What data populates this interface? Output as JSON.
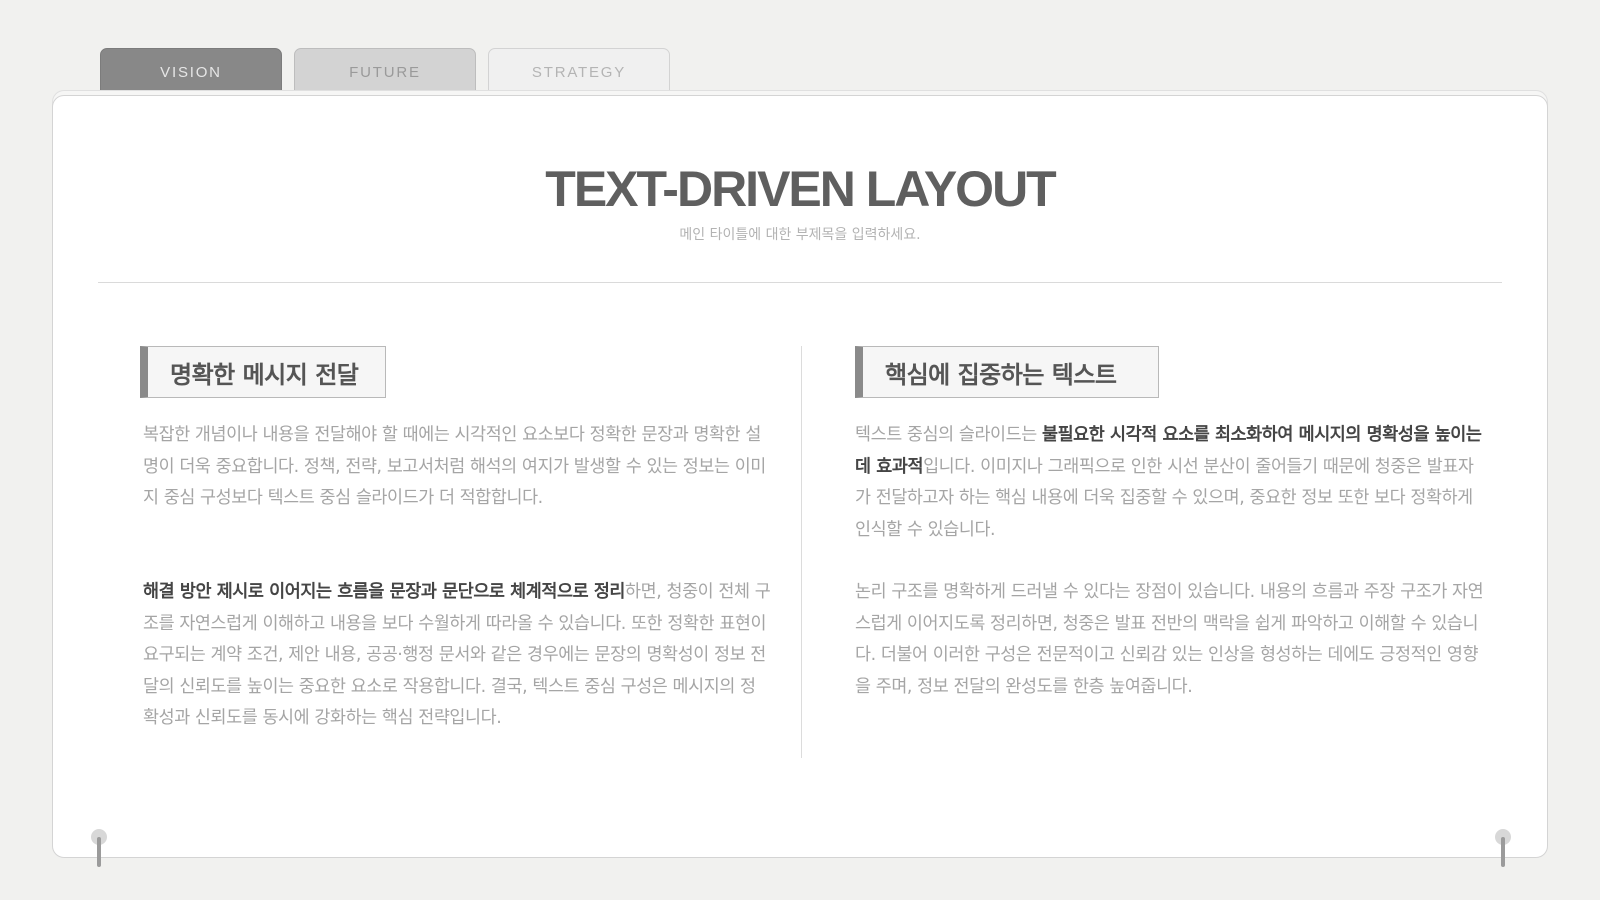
{
  "tabs": [
    {
      "label": "VISION",
      "active": true
    },
    {
      "label": "FUTURE",
      "active": false
    },
    {
      "label": "STRATEGY",
      "active": false
    }
  ],
  "title": "TEXT-DRIVEN LAYOUT",
  "subtitle": "메인 타이틀에 대한 부제목을 입력하세요.",
  "left": {
    "heading": "명확한 메시지 전달",
    "para1": "복잡한 개념이나 내용을 전달해야 할 때에는 시각적인 요소보다 정확한 문장과 명확한 설명이 더욱 중요합니다. 정책, 전략, 보고서처럼 해석의 여지가 발생할 수 있는 정보는 이미지 중심 구성보다 텍스트 중심 슬라이드가 더 적합합니다.",
    "para2_bold": "해결 방안 제시로 이어지는 흐름을 문장과 문단으로 체계적으로 정리",
    "para2_rest": "하면, 청중이 전체 구조를 자연스럽게 이해하고 내용을 보다 수월하게 따라올 수 있습니다. 또한 정확한 표현이 요구되는 계약 조건, 제안 내용, 공공·행정 문서와 같은 경우에는 문장의 명확성이 정보 전달의 신뢰도를 높이는 중요한 요소로 작용합니다. 결국, 텍스트 중심 구성은 메시지의 정확성과 신뢰도를 동시에 강화하는 핵심 전략입니다."
  },
  "right": {
    "heading": "핵심에 집중하는 텍스트",
    "para1_pre": "텍스트 중심의 슬라이드는 ",
    "para1_bold": "불필요한 시각적 요소를 최소화하여 메시지의 명확성을 높이는 데 효과적",
    "para1_rest": "입니다. 이미지나 그래픽으로 인한 시선 분산이 줄어들기 때문에 청중은 발표자가 전달하고자 하는 핵심 내용에 더욱 집중할 수 있으며, 중요한 정보 또한 보다 정확하게 인식할 수 있습니다.",
    "para2": "논리 구조를 명확하게 드러낼 수 있다는 장점이 있습니다. 내용의 흐름과 주장 구조가 자연스럽게 이어지도록 정리하면, 청중은 발표 전반의 맥락을 쉽게 파악하고 이해할 수 있습니다. 더불어 이러한 구성은 전문적이고 신뢰감 있는 인상을 형성하는 데에도 긍정적인 영향을 주며, 정보 전달의 완성도를 한층 높여줍니다."
  }
}
